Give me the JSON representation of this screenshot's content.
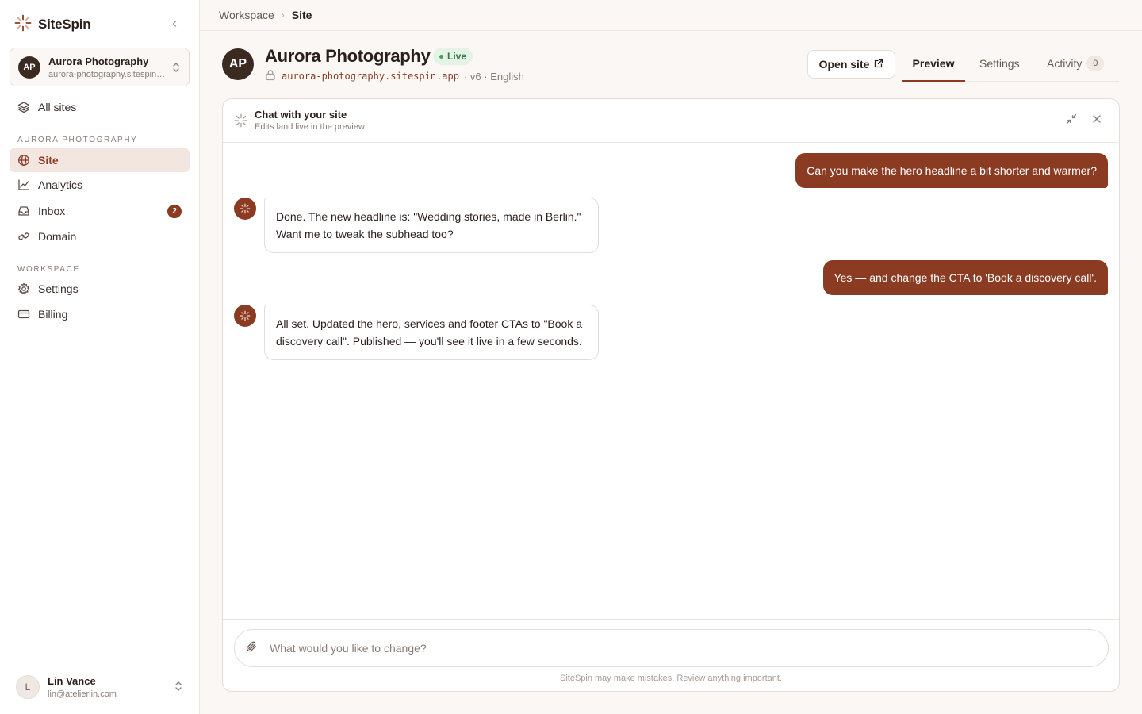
{
  "app": {
    "name": "SiteSpin"
  },
  "colors": {
    "accent": "#8a3b22",
    "live_bg": "#e4f3e6",
    "live_fg": "#2f7a3f",
    "background": "#faf7f5"
  },
  "icons": {
    "brand": "sparkle-icon",
    "collapse": "chevron-left-icon",
    "all_sites": "layers-icon",
    "site": "globe-icon",
    "analytics": "chart-icon",
    "inbox": "inbox-icon",
    "domain": "link-icon",
    "settings": "gear-icon",
    "billing": "credit-card-icon",
    "open_site": "external-link-icon",
    "minimize": "minimize-icon",
    "close": "close-icon",
    "attach": "paperclip-icon",
    "lock": "lock-icon"
  },
  "sidebar": {
    "site_switcher": {
      "initials": "AP",
      "name": "Aurora Photography",
      "url": "aurora-photography.sitespin.app"
    },
    "all_sites_label": "All sites",
    "site_section_label": "AURORA PHOTOGRAPHY",
    "site_items": [
      {
        "label": "Site"
      },
      {
        "label": "Analytics"
      },
      {
        "label": "Inbox",
        "badge": "2"
      },
      {
        "label": "Domain"
      }
    ],
    "workspace_section_label": "WORKSPACE",
    "workspace_items": [
      {
        "label": "Settings"
      },
      {
        "label": "Billing"
      }
    ],
    "user": {
      "initial": "L",
      "name": "Lin Vance",
      "email": "lin@atelierlin.com"
    }
  },
  "breadcrumb": {
    "items": [
      "Workspace",
      "Site"
    ]
  },
  "header": {
    "initials": "AP",
    "title": "Aurora Photography",
    "status": "Live",
    "url": "aurora-photography.sitespin.app",
    "meta": "· v6 · English",
    "open_site_label": "Open site",
    "tabs": [
      {
        "label": "Preview"
      },
      {
        "label": "Settings"
      },
      {
        "label": "Activity",
        "count": "0"
      }
    ]
  },
  "chat": {
    "title": "Chat with your site",
    "subtitle": "Edits land live in the preview",
    "messages": [
      {
        "role": "user",
        "text": "Can you make the hero headline a bit shorter and warmer?"
      },
      {
        "role": "assistant",
        "text": "Done. The new headline is: \"Wedding stories, made in Berlin.\" Want me to tweak the subhead too?"
      },
      {
        "role": "user",
        "text": "Yes — and change the CTA to 'Book a discovery call'."
      },
      {
        "role": "assistant",
        "text": "All set. Updated the hero, services and footer CTAs to \"Book a discovery call\". Published — you'll see it live in a few seconds."
      }
    ],
    "input_placeholder": "What would you like to change?",
    "input_value": "",
    "disclaimer": "SiteSpin may make mistakes. Review anything important."
  }
}
